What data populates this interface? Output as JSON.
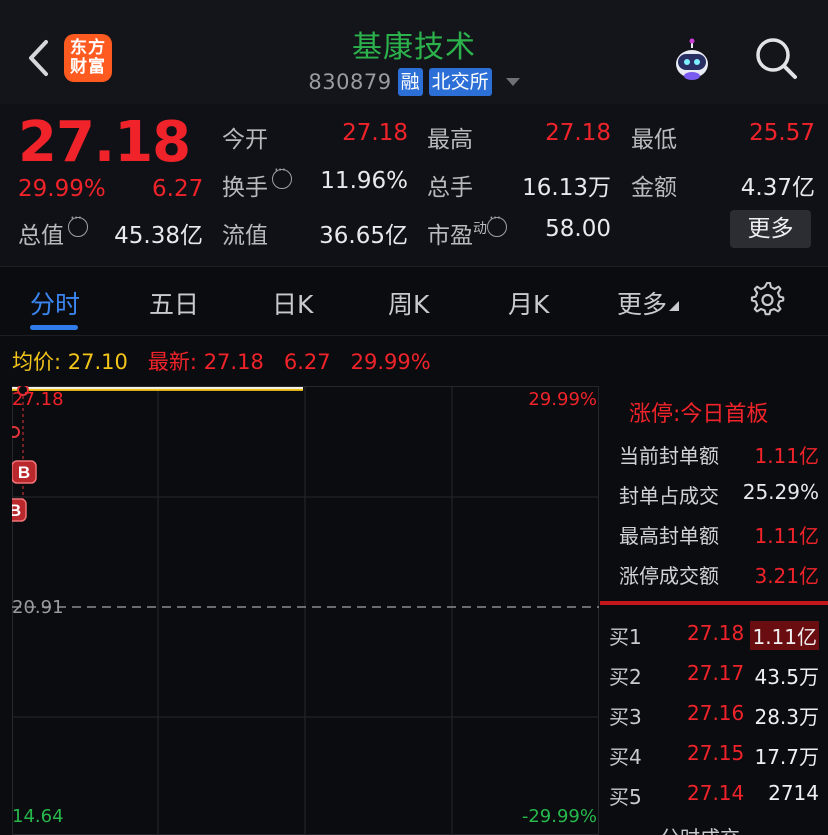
{
  "header": {
    "logo_line1": "东方",
    "logo_line2": "财富",
    "stock_name": "基康技术",
    "stock_code": "830879",
    "tag_margin": "融",
    "tag_exchange": "北交所",
    "colors": {
      "name_green": "#2bb24c",
      "logo_orange": "#ff5a1f",
      "tag_blue": "#2c6fd6"
    }
  },
  "quote": {
    "price": "27.18",
    "change_pct": "29.99%",
    "change_val": "6.27",
    "stats": [
      {
        "label": "今开",
        "value": "27.18"
      },
      {
        "label": "最高",
        "value": "27.18"
      },
      {
        "label": "最低",
        "value": "25.57"
      },
      {
        "label": "换手",
        "value": "11.96%"
      },
      {
        "label": "总手",
        "value": "16.13万"
      },
      {
        "label": "金额",
        "value": "4.37亿"
      },
      {
        "label": "总值",
        "value": "45.38亿"
      },
      {
        "label": "流值",
        "value": "36.65亿"
      },
      {
        "label": "市盈",
        "sup": "动",
        "value": "58.00"
      }
    ],
    "more_label": "更多"
  },
  "tabs": [
    {
      "label": "分时",
      "active": true
    },
    {
      "label": "五日"
    },
    {
      "label": "日K"
    },
    {
      "label": "周K"
    },
    {
      "label": "月K"
    },
    {
      "label": "更多"
    }
  ],
  "info_line": {
    "avg_label": "均价:",
    "avg_value": "27.10",
    "latest_label": "最新:",
    "latest_price": "27.18",
    "latest_change": "6.27",
    "latest_pct": "29.99%"
  },
  "chart": {
    "y_top": "27.18",
    "y_mid": "20.91",
    "y_bottom": "14.64",
    "pct_top": "29.99%",
    "pct_bottom": "-29.99%",
    "marker_b1": "B",
    "marker_b2": "B"
  },
  "chart_data": {
    "type": "line",
    "y_range": [
      14.64,
      27.18
    ],
    "reference_price": 20.91,
    "series": [
      {
        "values": [
          27.18,
          27.18,
          27.18,
          27.18,
          27.18
        ]
      }
    ]
  },
  "limit_up": {
    "title": "涨停:今日首板",
    "rows": [
      {
        "label": "当前封单额",
        "value": "1.11亿",
        "color": "red"
      },
      {
        "label": "封单占成交",
        "value": "25.29%",
        "color": "white"
      },
      {
        "label": "最高封单额",
        "value": "1.11亿",
        "color": "red"
      },
      {
        "label": "涨停成交额",
        "value": "3.21亿",
        "color": "red"
      }
    ]
  },
  "bids": [
    {
      "label": "买1",
      "price": "27.18",
      "volume": "1.11亿",
      "highlight": true
    },
    {
      "label": "买2",
      "price": "27.17",
      "volume": "43.5万"
    },
    {
      "label": "买3",
      "price": "27.16",
      "volume": "28.3万"
    },
    {
      "label": "买4",
      "price": "27.15",
      "volume": "17.7万"
    },
    {
      "label": "买5",
      "price": "27.14",
      "volume": "2714"
    }
  ],
  "bottom_section_title": "分时成交"
}
